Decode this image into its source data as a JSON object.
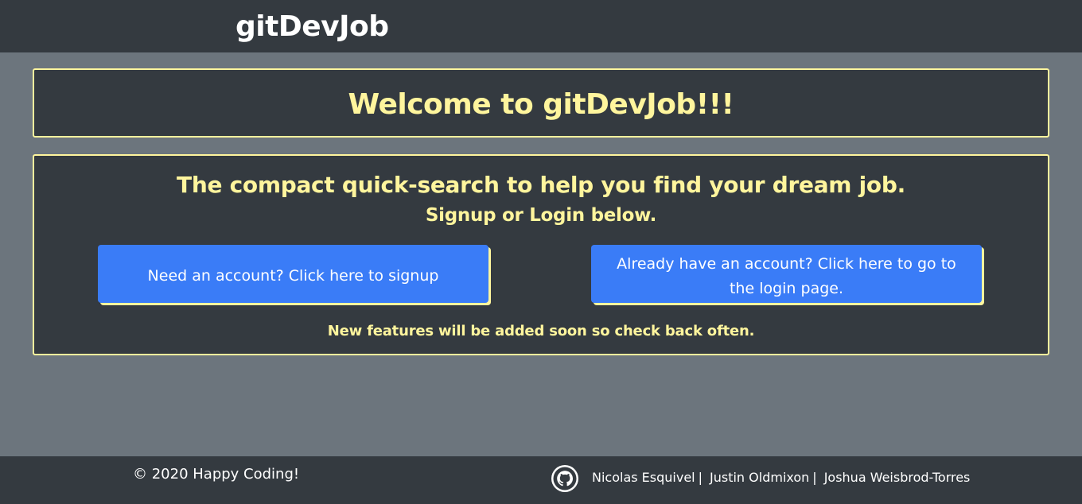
{
  "navbar": {
    "brand": "gitDevJob"
  },
  "welcome": {
    "title": "Welcome to gitDevJob!!!"
  },
  "main": {
    "tagline": "The compact quick-search to help you find your dream job.",
    "subtagline": "Signup or Login below.",
    "signup_button": "Need an account? Click here to signup",
    "login_button": "Already have an account? Click here to go to the login page.",
    "notice": "New features will be added soon so check back often."
  },
  "footer": {
    "copyright": "© 2020 Happy Coding!",
    "icon": "github-icon",
    "authors": [
      "Nicolas Esquivel",
      "Justin Oldmixon",
      "Joshua Weisbrod-Torres"
    ],
    "separator": "|"
  },
  "colors": {
    "page_background": "#6c757d",
    "dark_panel": "#343a40",
    "accent_yellow": "#fff59d",
    "button_blue": "#3a7cf7",
    "text_white": "#ffffff"
  }
}
